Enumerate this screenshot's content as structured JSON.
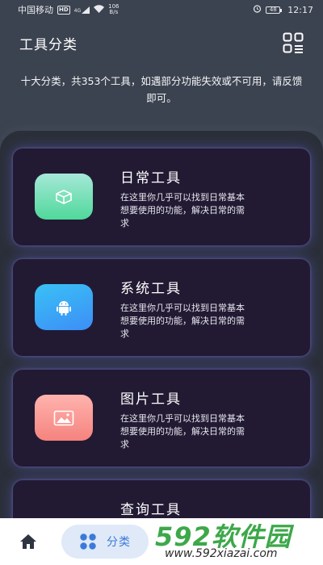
{
  "status_bar": {
    "carrier": "中国移动",
    "hd_badge": "HD",
    "signal": "4G",
    "net_speed_value": "106",
    "net_speed_unit": "B/s",
    "battery": "48",
    "time": "12:17"
  },
  "header": {
    "title": "工具分类"
  },
  "subtitle": "十大分类，共353个工具，如遇部分功能失效或不可用，请反馈即可。",
  "cards": [
    {
      "title": "日常工具",
      "desc": "在这里你几乎可以找到日常基本想要使用的功能，解决日常的需求",
      "icon": "box-icon",
      "gradient_from": "#a6e8d8",
      "gradient_to": "#4fd89a"
    },
    {
      "title": "系统工具",
      "desc": "在这里你几乎可以找到日常基本想要使用的功能，解决日常的需求",
      "icon": "android-icon",
      "gradient_from": "#3ac1f5",
      "gradient_to": "#3c8ef7"
    },
    {
      "title": "图片工具",
      "desc": "在这里你几乎可以找到日常基本想要使用的功能，解决日常的需求",
      "icon": "image-icon",
      "gradient_from": "#ffb3ae",
      "gradient_to": "#f5837e"
    },
    {
      "title": "查询工具",
      "desc": "",
      "icon": "",
      "gradient_from": "",
      "gradient_to": ""
    }
  ],
  "bottom_nav": {
    "category_label": "分类"
  },
  "watermark": {
    "main": "592软件园",
    "url": "www.592xiazai.com"
  },
  "colors": {
    "background": "#3c4350",
    "panel": "#2a2f39",
    "card": "#221a33",
    "accent": "#3c7ad8"
  }
}
